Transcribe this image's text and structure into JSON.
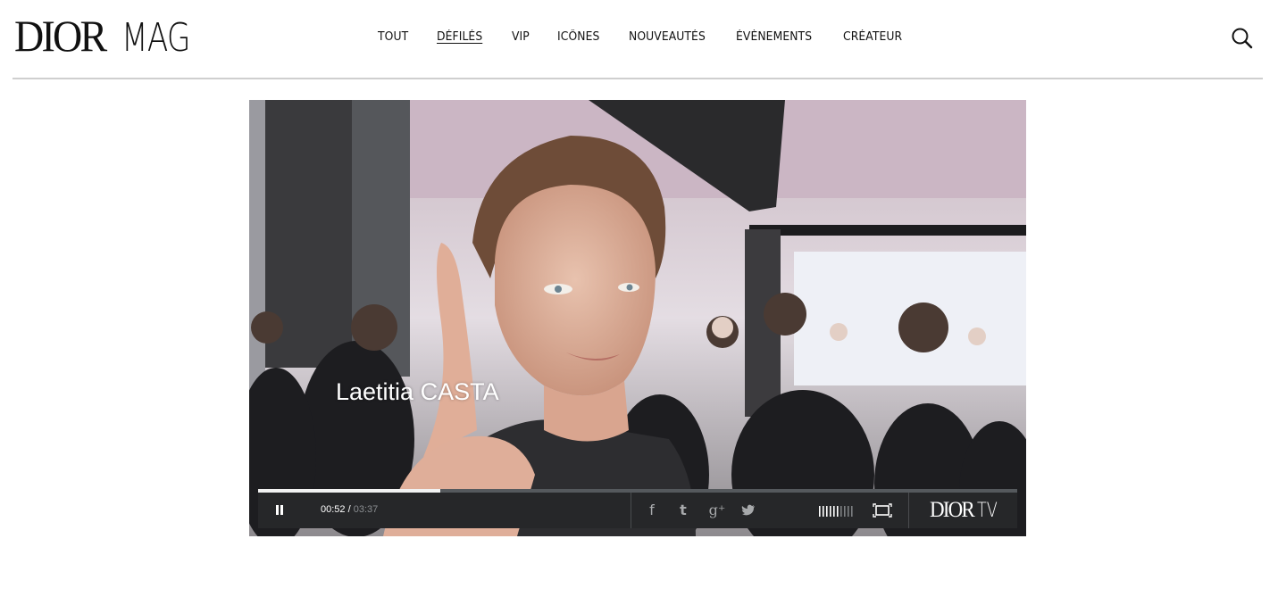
{
  "header": {
    "logo_dior": "DIOR",
    "logo_mag": "MAG",
    "nav": [
      {
        "label": "TOUT",
        "active": false
      },
      {
        "label": "DÉFILÉS",
        "active": true
      },
      {
        "label": "VIP",
        "active": false
      },
      {
        "label": "ICÔNES",
        "active": false
      },
      {
        "label": "NOUVEAUTÉS",
        "active": false
      },
      {
        "label": "ÉVÈNEMENTS",
        "active": false
      },
      {
        "label": "CRÉATEUR",
        "active": false
      }
    ],
    "search_icon": "search-icon"
  },
  "video": {
    "caption": "Laetitia CASTA",
    "current_time": "00:52 /",
    "total_time": "03:37",
    "progress_fraction": 0.24,
    "volume_level_fraction": 0.6,
    "social": [
      {
        "name": "facebook-icon",
        "glyph": "f"
      },
      {
        "name": "tumblr-icon",
        "glyph": "t"
      },
      {
        "name": "google-plus-icon",
        "glyph": "g⁺"
      },
      {
        "name": "twitter-icon",
        "glyph": "🐦"
      }
    ],
    "brand_dior": "DIOR",
    "brand_tv": "TV",
    "colors": {
      "controls_bg": "#262729",
      "progress_fill": "#f2f2f2",
      "progress_track": "#55595d",
      "icon_gray": "#a7a9ab"
    }
  }
}
